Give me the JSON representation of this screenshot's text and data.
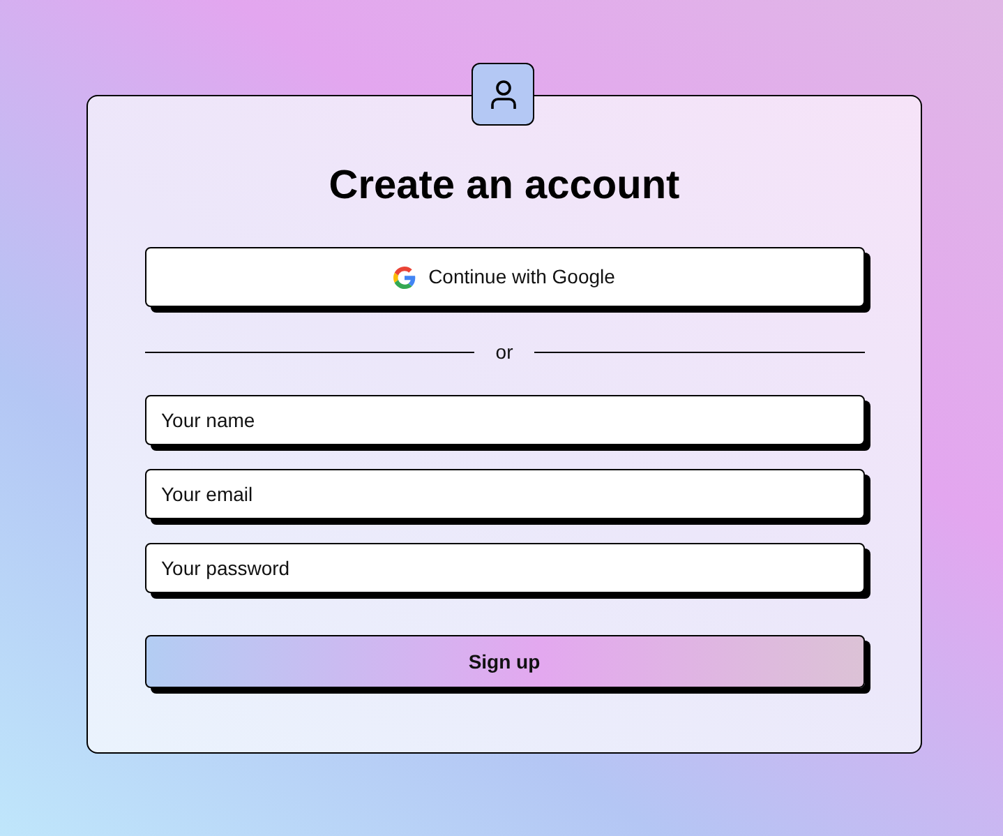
{
  "title": "Create an account",
  "google_button": {
    "label": "Continue with Google"
  },
  "divider": {
    "label": "or"
  },
  "fields": [
    {
      "placeholder": "Your name"
    },
    {
      "placeholder": "Your email"
    },
    {
      "placeholder": "Your password"
    }
  ],
  "submit_button": {
    "label": "Sign up"
  }
}
